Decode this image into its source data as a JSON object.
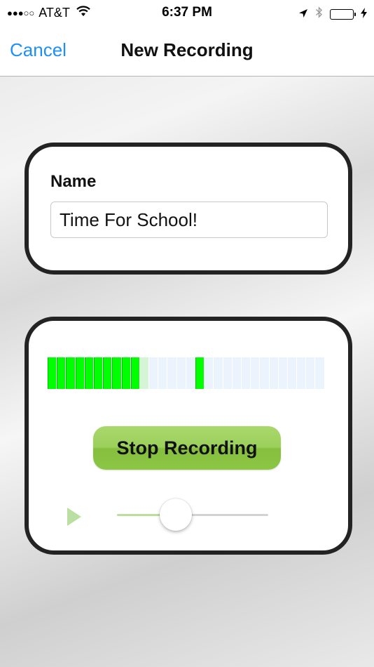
{
  "status_bar": {
    "signal": "●●●○○",
    "carrier": "AT&T",
    "time": "6:37 PM",
    "icons": [
      "wifi-icon",
      "location-arrow-icon",
      "bluetooth-icon",
      "battery-icon",
      "charging-bolt-icon"
    ],
    "battery_color": "#43d54a"
  },
  "nav": {
    "cancel_label": "Cancel",
    "title": "New Recording",
    "accent_color": "#1e8ff5"
  },
  "name_card": {
    "label": "Name",
    "input_value": "Time For School!"
  },
  "recorder": {
    "meter": {
      "total_segments": 30,
      "lit_segments": [
        0,
        1,
        2,
        3,
        4,
        5,
        6,
        7,
        8,
        9
      ],
      "faint_segments": [
        10
      ],
      "peak_segment": 16,
      "lit_color": "#00ff00"
    },
    "stop_label": "Stop Recording",
    "play_icon": "play-icon",
    "playback_position": 0.39
  }
}
